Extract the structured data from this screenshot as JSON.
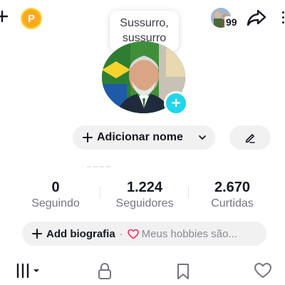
{
  "header": {
    "coin_letter": "P",
    "thought_bubble": "Sussurro,\nsussurro",
    "visitors_count": "99",
    "icons": [
      "plus-icon",
      "coin-icon",
      "visitors-avatar",
      "share-icon",
      "more-icon"
    ]
  },
  "profile": {
    "add_name_label": "Adicionar nome",
    "add_photo_symbol": "+"
  },
  "stats": [
    {
      "value": "0",
      "label": "Seguindo"
    },
    {
      "value": "1.224",
      "label": "Seguidores"
    },
    {
      "value": "2.670",
      "label": "Curtidas"
    }
  ],
  "bio": {
    "add_label": "Add biografia",
    "separator": "·",
    "hint": "Meus hobbies são..."
  },
  "tabs": {
    "icons": [
      "grid-icon",
      "lock-icon",
      "bookmark-icon",
      "heart-icon"
    ]
  },
  "colors": {
    "accent": "#20d5ec",
    "coin": "#f7b500",
    "heart": "#fe2c55",
    "pill_bg": "#f1f1f2",
    "muted_text": "#75767d"
  }
}
